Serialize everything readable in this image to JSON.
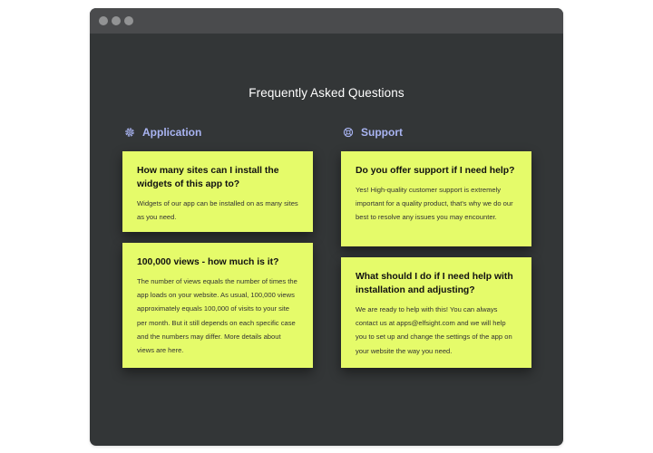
{
  "window": {
    "controls": [
      "close",
      "minimize",
      "maximize"
    ]
  },
  "page": {
    "title": "Frequently Asked Questions"
  },
  "sections": [
    {
      "label": "Application",
      "icon": "gear-icon",
      "items": [
        {
          "question": "How many sites can I install the widgets of this app to?",
          "answer": "Widgets of our app can be installed on as many sites as you need."
        },
        {
          "question": "100,000 views - how much is it?",
          "answer": "The number of views equals the number of times the app loads on your website. As usual, 100,000 views approximately equals 100,000 of visits to your site per month. But it still depends on  each specific case and the numbers may differ. More details about views are here."
        }
      ]
    },
    {
      "label": "Support",
      "icon": "lifebuoy-icon",
      "items": [
        {
          "question": "Do you offer support if I need help?",
          "answer": "Yes! High-quality customer support is extremely important for a quality product, that's why we do our best to resolve any issues you may encounter."
        },
        {
          "question": "What should I do if I need help with installation and adjusting?",
          "answer": "We are ready to help with this! You can always contact us at apps@elfsight.com and we will help you to set up and change the settings of the app on your website the way you need."
        }
      ]
    }
  ],
  "colors": {
    "background": "#333637",
    "titlebar": "#4a4b4d",
    "card": "#e5fb6a",
    "section_label": "#a9b4f2",
    "title_text": "#ffffff"
  }
}
